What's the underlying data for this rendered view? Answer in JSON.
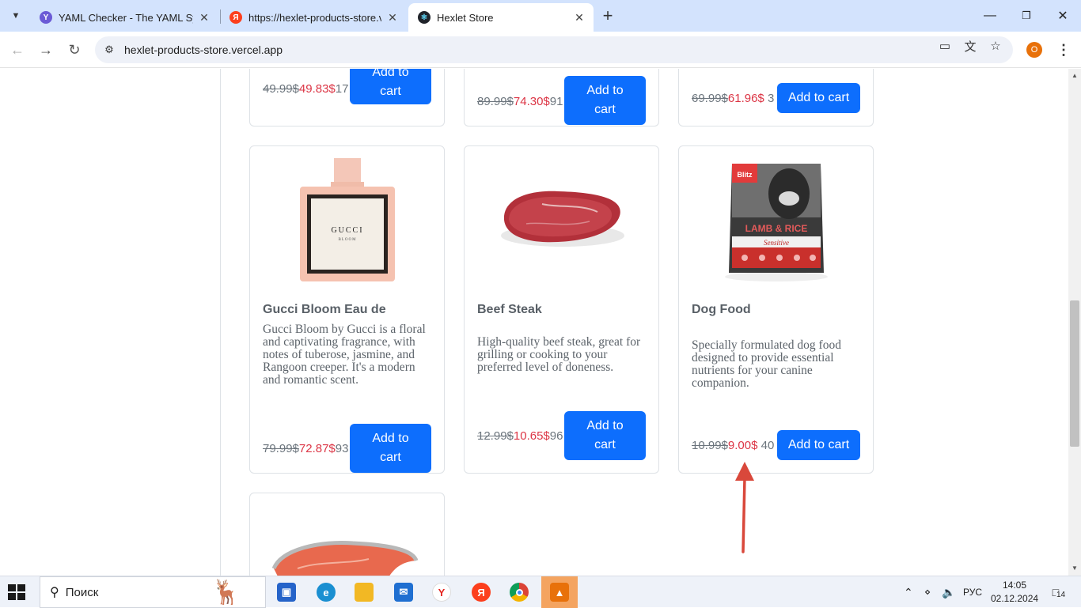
{
  "browser": {
    "tabs": [
      {
        "title": "YAML Checker - The YAML Synt",
        "favicon": "yaml-checker-favicon"
      },
      {
        "title": "https://hexlet-products-store.ve",
        "favicon": "yandex-favicon"
      },
      {
        "title": "Hexlet Store",
        "favicon": "react-favicon"
      }
    ],
    "url": "hexlet-products-store.vercel.app",
    "profile_initial": "O"
  },
  "products_top_row": [
    {
      "old_price": "49.99$",
      "new_price": "49.83$",
      "stock": "17",
      "button": "Add to cart"
    },
    {
      "old_price": "89.99$",
      "new_price": "74.30$",
      "stock": "91",
      "button": "Add to cart"
    },
    {
      "old_price": "69.99$",
      "new_price": "61.96$",
      "stock": "3",
      "button": "Add to cart"
    }
  ],
  "products": [
    {
      "title": "Gucci Bloom Eau de",
      "description": "Gucci Bloom by Gucci is a floral and captivating fragrance, with notes of tuberose, jasmine, and Rangoon creeper. It's a modern and romantic scent.",
      "old_price": "79.99$",
      "new_price": "72.87$",
      "stock": "93",
      "button": "Add to cart",
      "image": "perfume-bottle-image",
      "bottle_label": "GUCCI",
      "bottle_sublabel": "BLOOM"
    },
    {
      "title": "Beef Steak",
      "description": "High-quality beef steak, great for grilling or cooking to your preferred level of doneness.",
      "old_price": "12.99$",
      "new_price": "10.65$",
      "stock": "96",
      "button": "Add to cart",
      "image": "beef-steak-image"
    },
    {
      "title": "Dog Food",
      "description": "Specially formulated dog food designed to provide essential nutrients for your canine companion.",
      "old_price": "10.99$",
      "new_price": "9.00$",
      "stock": "40",
      "button": "Add to cart",
      "image": "dog-food-bag-image",
      "bag_brand": "Blitz",
      "bag_text": "LAMB & RICE",
      "bag_subtext": "Sensitive"
    }
  ],
  "annotation_color": "#d9483b",
  "taskbar": {
    "search_placeholder": "Поиск",
    "language": "РУС",
    "time": "14:05",
    "date": "02.12.2024",
    "notification_count": "14"
  }
}
